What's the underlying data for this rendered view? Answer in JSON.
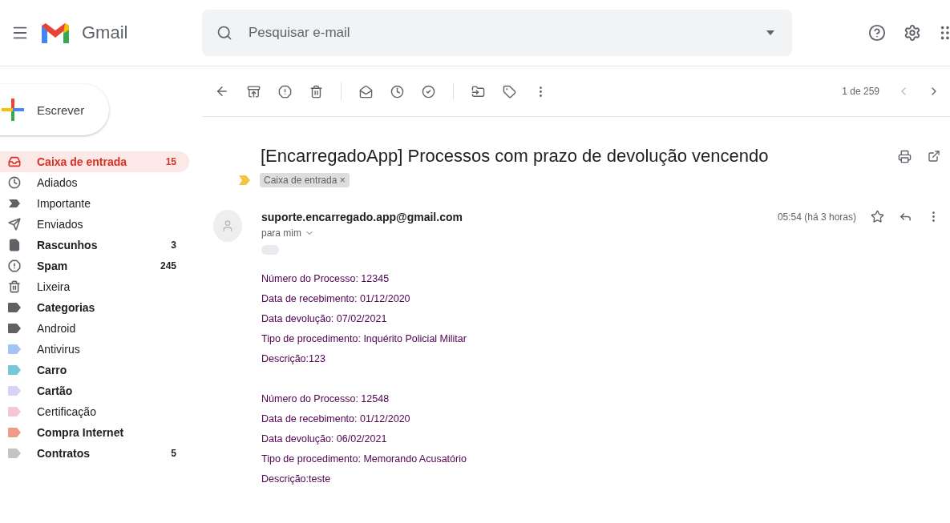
{
  "header": {
    "app_name": "Gmail",
    "search": {
      "placeholder": "Pesquisar e-mail"
    }
  },
  "compose": {
    "label": "Escrever"
  },
  "sidebar": {
    "items": [
      {
        "kind": "inbox",
        "label": "Caixa de entrada",
        "count": "15",
        "selected": true,
        "unread": true
      },
      {
        "kind": "snoozed",
        "label": "Adiados",
        "selected": false,
        "unread": false
      },
      {
        "kind": "important",
        "label": "Importante",
        "selected": false,
        "unread": false
      },
      {
        "kind": "sent",
        "label": "Enviados",
        "selected": false,
        "unread": false
      },
      {
        "kind": "drafts",
        "label": "Rascunhos",
        "count": "3",
        "selected": false,
        "unread": true
      },
      {
        "kind": "spam",
        "label": "Spam",
        "count": "245",
        "selected": false,
        "unread": true
      },
      {
        "kind": "trash",
        "label": "Lixeira",
        "selected": false,
        "unread": false
      },
      {
        "kind": "label",
        "label": "Categorias",
        "color": "#616161",
        "selected": false,
        "unread": true
      },
      {
        "kind": "label",
        "label": "Android",
        "color": "#616161",
        "selected": false,
        "unread": false
      },
      {
        "kind": "label",
        "label": "Antivirus",
        "color": "#a4c2f4",
        "selected": false,
        "unread": false
      },
      {
        "kind": "label",
        "label": "Carro",
        "color": "#76c7d9",
        "selected": false,
        "unread": true
      },
      {
        "kind": "label",
        "label": "Cartão",
        "color": "#d9d2f7",
        "selected": false,
        "unread": true
      },
      {
        "kind": "label",
        "label": "Certificação",
        "color": "#f7c6d4",
        "selected": false,
        "unread": false
      },
      {
        "kind": "label",
        "label": "Compra Internet",
        "color": "#ef9a8a",
        "selected": false,
        "unread": true
      },
      {
        "kind": "label",
        "label": "Contratos",
        "count": "5",
        "color": "#c4c4c4",
        "selected": false,
        "unread": true
      }
    ]
  },
  "toolbar": {
    "pager": "1 de 259"
  },
  "message": {
    "subject": "[EncarregadoApp] Processos com prazo de devolução vencendo",
    "chip": {
      "label": "Caixa de entrada",
      "remove": "×"
    },
    "sender": "suporte.encarregado.app@gmail.com",
    "recipient": "para mim",
    "time": "05:54 (há 3 horas)",
    "starred": false,
    "body": [
      [
        "Número do Processo: 12345",
        "Data de recebimento: 01/12/2020",
        "Data devolução: 07/02/2021",
        "Tipo de procedimento: Inquérito Policial Militar",
        "Descrição:123"
      ],
      [
        "Número do Processo: 12548",
        "Data de recebimento: 01/12/2020",
        "Data devolução: 06/02/2021",
        "Tipo de procedimento: Memorando Acusatório",
        "Descrição:teste"
      ]
    ]
  }
}
